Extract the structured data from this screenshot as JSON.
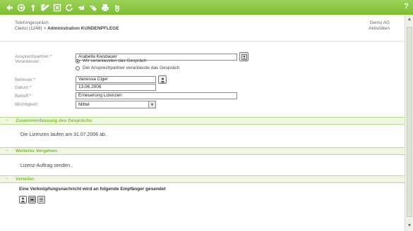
{
  "toolbar": {
    "icons": [
      "back-icon",
      "forward-icon",
      "save-icon",
      "edit-icon",
      "delete-icon",
      "refresh-icon",
      "link-icon",
      "tag-icon",
      "print-icon",
      "attach-icon"
    ],
    "help_label": "?",
    "color": "#7cbd31"
  },
  "header": {
    "type_label": "Telefongespräch",
    "path_prefix": "Clerici (1248) > ",
    "path_title": "Administration KUNDENPFLEGE",
    "company": "Demo AG",
    "activities": "Aktivitäten"
  },
  "form": {
    "contact_label": "Ansprechpartner:*",
    "contact_value": "Arabella Kiesbauer",
    "initiator_label": "Veranlasser:",
    "initiator_option_1": "Wir veranlassten das Gespräch",
    "initiator_option_2": "Der Ansprechpartner veranlasste das Gespräch",
    "initiator_selected": 1,
    "owner_label": "Betreuer:*",
    "owner_value": "Vanessa Ciger",
    "date_label": "Datum:*",
    "date_value": "13.06.2006",
    "subject_label": "Betreff:*",
    "subject_value": "Erneuerung Lizenzen",
    "priority_label": "Wichtigkeit:",
    "priority_value": "Mittel"
  },
  "sections": {
    "summary": {
      "title": "Zusammenfassung des Gesprächs:",
      "text": "Die Lizenzen laufen am 31.07.2006 ab."
    },
    "next_steps": {
      "title": "Weiteres Vorgehen:",
      "text": "Lizenz-Auftrag senden."
    },
    "distribution": {
      "title": "Verteiler:",
      "note": "Eine Verknüpfungsnachricht wird an folgende Empfänger gesendet"
    }
  }
}
